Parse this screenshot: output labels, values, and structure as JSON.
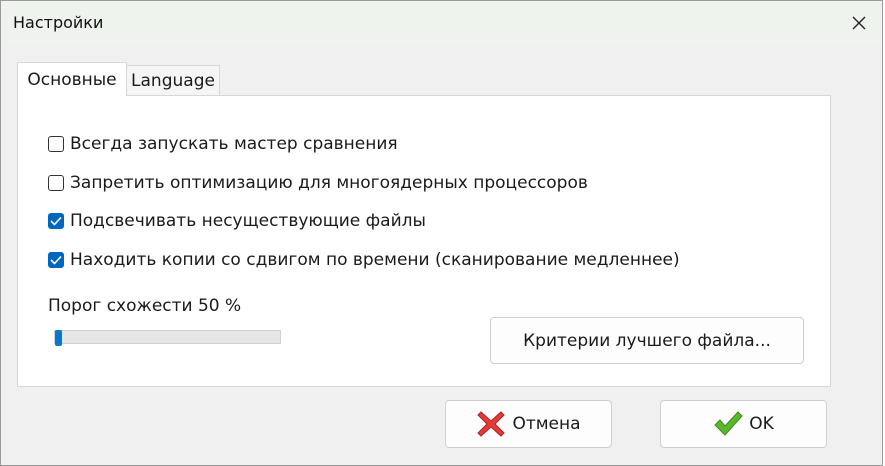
{
  "window": {
    "title": "Настройки"
  },
  "tabs": [
    {
      "label": "Основные",
      "active": true
    },
    {
      "label": "Language",
      "active": false
    }
  ],
  "options": [
    {
      "label": "Всегда запускать мастер сравнения",
      "checked": false
    },
    {
      "label": "Запретить оптимизацию для многоядерных процессоров",
      "checked": false
    },
    {
      "label": "Подсвечивать несуществующие файлы",
      "checked": true
    },
    {
      "label": "Находить копии со сдвигом по времени (сканирование медленнее)",
      "checked": true
    }
  ],
  "threshold": {
    "label": "Порог схожести 50 %",
    "value_fraction": 0.0
  },
  "buttons": {
    "criteria": "Критерии лучшего файла...",
    "cancel": "Отмена",
    "ok": "OK"
  },
  "icons": {
    "close": "close-icon",
    "cancel": "red-x-icon",
    "ok": "green-check-icon"
  },
  "colors": {
    "accent": "#0067c0",
    "cancel_icon": "#e23b3b",
    "ok_icon": "#5bb82e"
  }
}
